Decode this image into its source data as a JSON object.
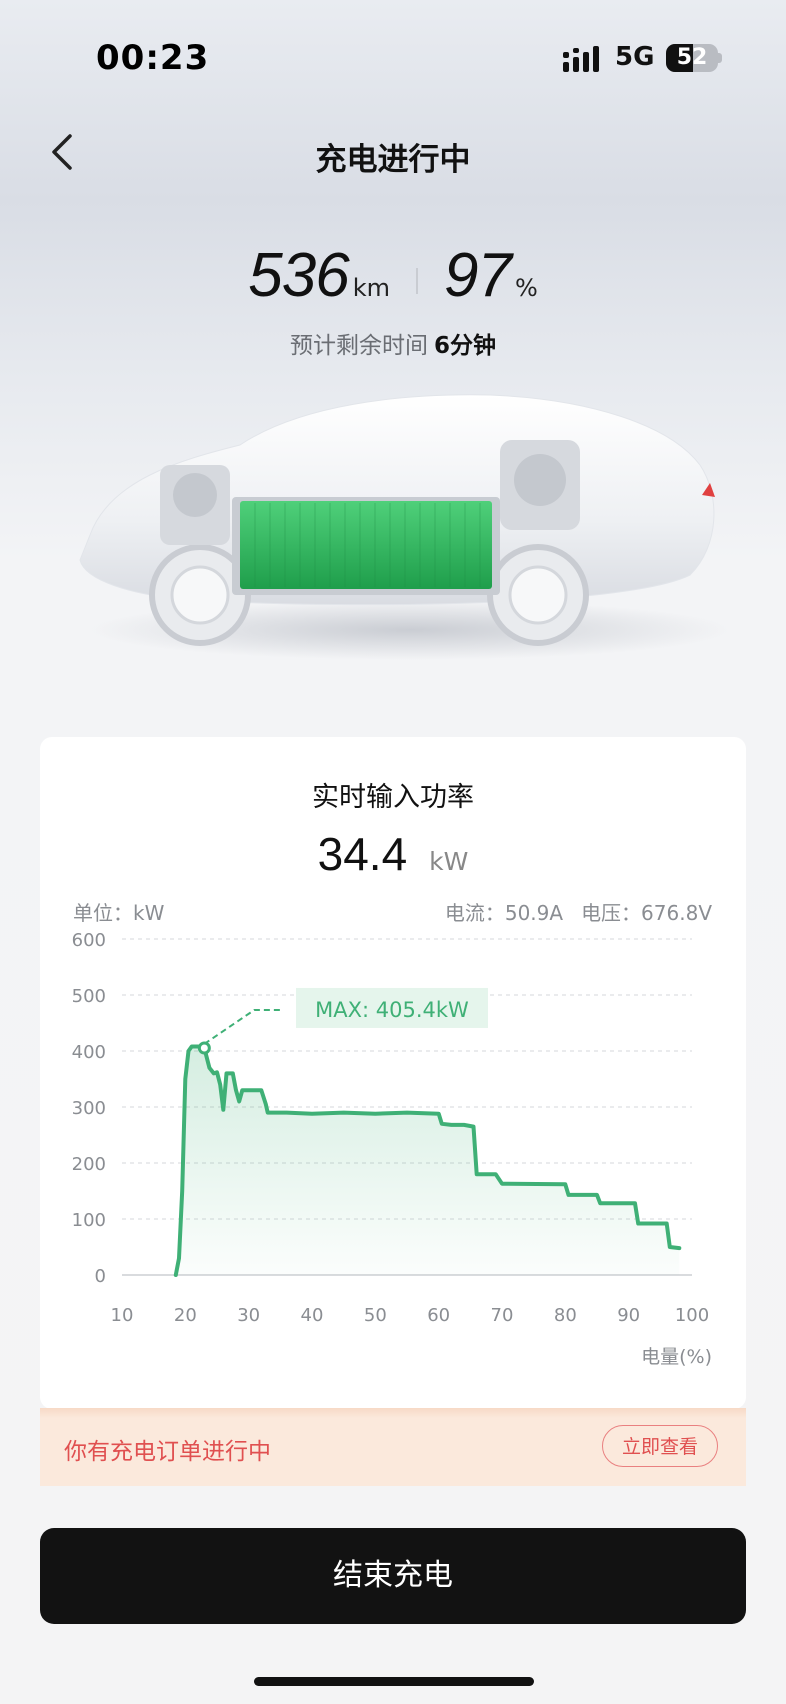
{
  "status_bar": {
    "time": "00:23",
    "network": "5G",
    "battery": "52"
  },
  "nav": {
    "title": "充电进行中",
    "back_icon": "chevron-left-icon"
  },
  "stats": {
    "range_value": "536",
    "range_unit": "km",
    "soc_value": "97",
    "soc_unit": "%",
    "eta_label": "预计剩余时间",
    "eta_value": "6分钟"
  },
  "card": {
    "title": "实时输入功率",
    "power_value": "34.4",
    "power_unit": "kW",
    "unit_label": "单位：kW",
    "current": "电流：50.9A",
    "voltage": "电压：676.8V"
  },
  "chart_data": {
    "type": "line",
    "title": "",
    "xlabel": "电量(%)",
    "ylabel": "",
    "xlim": [
      10,
      100
    ],
    "ylim": [
      0,
      600
    ],
    "x_ticks": [
      "10",
      "20",
      "30",
      "40",
      "50",
      "60",
      "70",
      "80",
      "90",
      "100"
    ],
    "y_ticks": [
      "0",
      "100",
      "200",
      "300",
      "400",
      "500",
      "600"
    ],
    "grid": true,
    "annotation": "MAX: 405.4kW",
    "max_point": {
      "x": 23,
      "y": 405.4
    },
    "series": [
      {
        "color": "#3fb076",
        "points": [
          [
            18.5,
            0
          ],
          [
            19,
            30
          ],
          [
            19.5,
            150
          ],
          [
            20,
            350
          ],
          [
            20.5,
            400
          ],
          [
            21,
            408
          ],
          [
            22,
            408
          ],
          [
            23,
            405.4
          ],
          [
            23.8,
            370
          ],
          [
            24.5,
            360
          ],
          [
            25,
            362
          ],
          [
            25.5,
            340
          ],
          [
            26,
            295
          ],
          [
            26.5,
            360
          ],
          [
            27.5,
            360
          ],
          [
            28,
            330
          ],
          [
            28.5,
            310
          ],
          [
            29,
            330
          ],
          [
            31,
            330
          ],
          [
            32,
            330
          ],
          [
            32.7,
            305
          ],
          [
            33,
            290
          ],
          [
            36,
            290
          ],
          [
            40,
            288
          ],
          [
            45,
            290
          ],
          [
            50,
            288
          ],
          [
            55,
            290
          ],
          [
            60,
            288
          ],
          [
            60.5,
            270
          ],
          [
            62,
            268
          ],
          [
            64,
            268
          ],
          [
            65.5,
            265
          ],
          [
            66,
            180
          ],
          [
            69,
            180
          ],
          [
            70,
            163
          ],
          [
            80,
            162
          ],
          [
            80.5,
            143
          ],
          [
            83,
            143
          ],
          [
            85,
            143
          ],
          [
            85.5,
            128
          ],
          [
            90,
            128
          ],
          [
            91,
            128
          ],
          [
            91.5,
            92
          ],
          [
            96,
            92
          ],
          [
            96.5,
            50
          ],
          [
            98,
            48
          ]
        ]
      }
    ]
  },
  "notice": {
    "text": "你有充电订单进行中",
    "button": "立即查看"
  },
  "end_button": "结束充电",
  "colors": {
    "accent": "#3fb076",
    "danger": "#e05050",
    "primary_button": "#121212"
  }
}
